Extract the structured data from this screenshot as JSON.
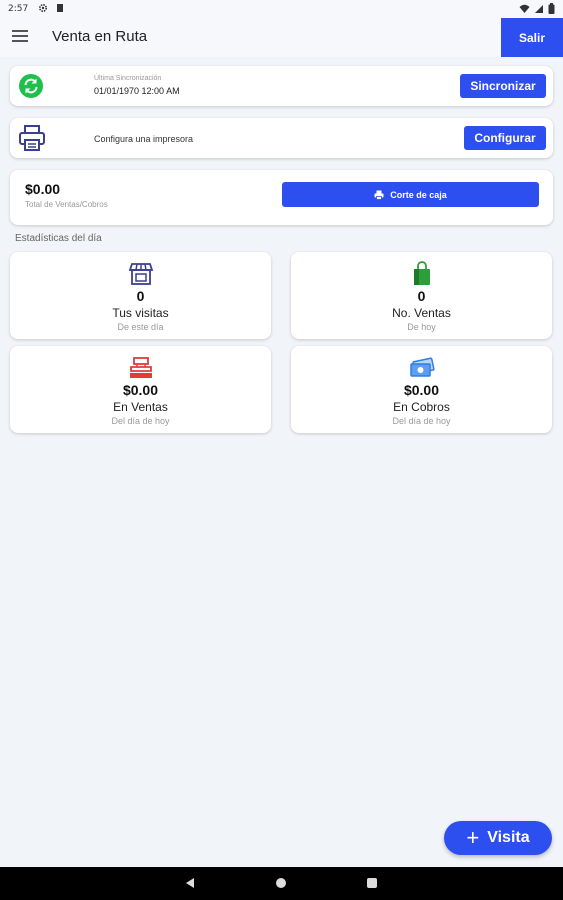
{
  "status_bar": {
    "time": "2:57",
    "icons": [
      "settings-icon",
      "sd-card-icon",
      "wifi-icon",
      "signal-icon",
      "battery-icon"
    ]
  },
  "app_bar": {
    "title": "Venta en Ruta",
    "logout_label": "Salir"
  },
  "sync_card": {
    "subtitle": "Última Sincronización",
    "date": "01/01/1970 12:00 AM",
    "button_label": "Sincronizar",
    "icon": "sync-icon"
  },
  "printer_card": {
    "text": "Configura una impresora",
    "button_label": "Configurar",
    "icon": "printer-icon"
  },
  "total_card": {
    "amount": "$0.00",
    "label": "Total de Ventas/Cobros",
    "button_label": "Corte de caja"
  },
  "stats": {
    "section_title": "Estadísticas del día",
    "items": [
      {
        "value": "0",
        "label": "Tus visitas",
        "sub": "De este día",
        "icon": "store-icon"
      },
      {
        "value": "0",
        "label": "No. Ventas",
        "sub": "De hoy",
        "icon": "shopping-bag-icon"
      },
      {
        "value": "$0.00",
        "label": "En Ventas",
        "sub": "Del día de hoy",
        "icon": "cash-register-icon"
      },
      {
        "value": "$0.00",
        "label": "En Cobros",
        "sub": "Del día de hoy",
        "icon": "money-icon"
      }
    ]
  },
  "fab": {
    "label": "Visita"
  },
  "colors": {
    "primary": "#2e4ff0",
    "sync_green": "#1fbf4c",
    "bag_green": "#2e9e3a",
    "register_red": "#e23b3b",
    "money_blue": "#2f7fe0",
    "store_navy": "#3a3f8f",
    "background": "#f1f4f9"
  }
}
